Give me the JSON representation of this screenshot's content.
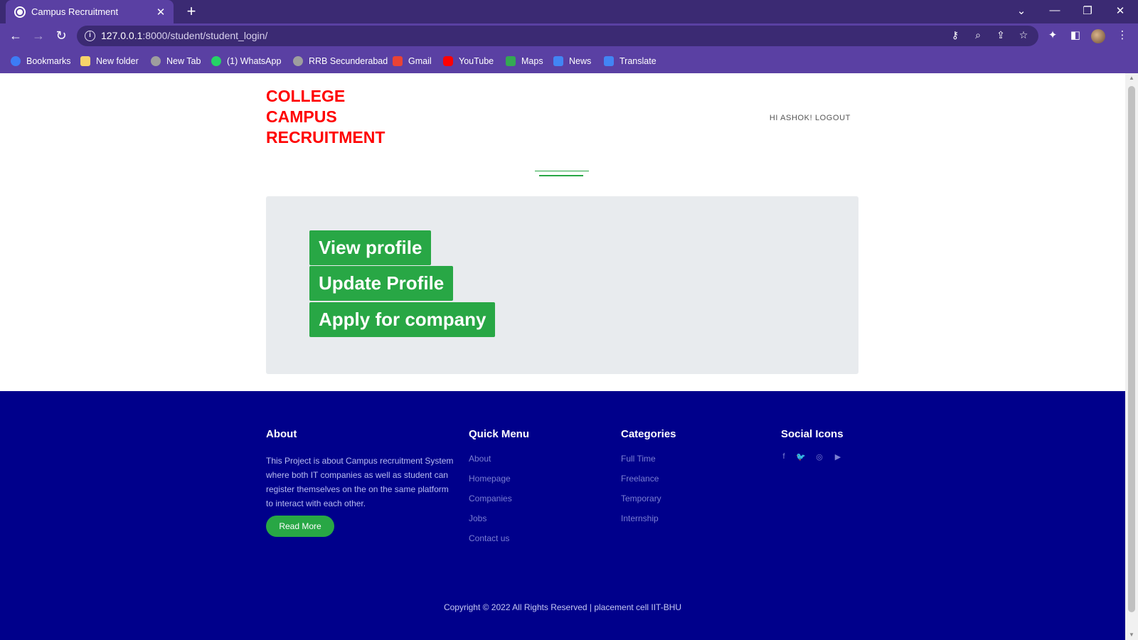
{
  "browser": {
    "tab_title": "Campus Recruitment",
    "tab_close": "✕",
    "new_tab": "+",
    "url_host": "127.0.0.1",
    "url_rest": ":8000/student/student_login/",
    "window_controls": {
      "list": "⌄",
      "minimize": "—",
      "restore": "❐",
      "close": "✕"
    },
    "nav": {
      "back": "←",
      "forward": "→",
      "reload": "↻"
    },
    "omnibox_icons": {
      "key": "⚷",
      "zoom": "⌕",
      "share": "⇪",
      "star": "☆"
    },
    "toolbar_icons": {
      "extensions": "✦",
      "side_panel": "◧",
      "menu": "⋮"
    },
    "bookmarks": [
      {
        "label": "Bookmarks",
        "icon": "star-icon",
        "color": "#3d7cf5"
      },
      {
        "label": "New folder",
        "icon": "folder-icon",
        "color": "#f7d36a"
      },
      {
        "label": "New Tab",
        "icon": "globe-icon",
        "color": "#9e9e9e"
      },
      {
        "label": "(1) WhatsApp",
        "icon": "whatsapp-icon",
        "color": "#25d366"
      },
      {
        "label": "RRB Secunderabad",
        "icon": "globe-icon",
        "color": "#9e9e9e"
      },
      {
        "label": "Gmail",
        "icon": "gmail-icon",
        "color": "#ea4335"
      },
      {
        "label": "YouTube",
        "icon": "youtube-icon",
        "color": "#ff0000"
      },
      {
        "label": "Maps",
        "icon": "maps-icon",
        "color": "#34a853"
      },
      {
        "label": "News",
        "icon": "news-icon",
        "color": "#4285f4"
      },
      {
        "label": "Translate",
        "icon": "translate-icon",
        "color": "#4285f4"
      }
    ]
  },
  "header": {
    "brand_lines": [
      "COLLEGE",
      "CAMPUS",
      "RECRUITMENT"
    ],
    "greeting": "HI ASHOK!",
    "logout": "LOGOUT",
    "brand_color": "#ff0000",
    "accent_color": "#28a745"
  },
  "actions": {
    "view_profile": "View profile",
    "update_profile": "Update Profile",
    "apply_company": "Apply for company"
  },
  "footer": {
    "background": "#00008b",
    "about": {
      "heading": "About",
      "text": "This Project is about Campus recruitment System where both IT companies as well as student can register themselves on the on the same platform to interact with each other.",
      "button": "Read More"
    },
    "quick_menu": {
      "heading": "Quick Menu",
      "links": [
        "About",
        "Homepage",
        "Companies",
        "Jobs",
        "Contact us"
      ]
    },
    "categories": {
      "heading": "Categories",
      "links": [
        "Full Time",
        "Freelance",
        "Temporary",
        "Internship"
      ]
    },
    "social": {
      "heading": "Social Icons",
      "icons": [
        {
          "name": "facebook-icon",
          "glyph": "f"
        },
        {
          "name": "twitter-icon",
          "glyph": "🐦"
        },
        {
          "name": "instagram-icon",
          "glyph": "◎"
        },
        {
          "name": "youtube-icon",
          "glyph": "▶"
        }
      ]
    },
    "copyright": "Copyright © 2022 All Rights Reserved | placement cell IIT-BHU"
  }
}
